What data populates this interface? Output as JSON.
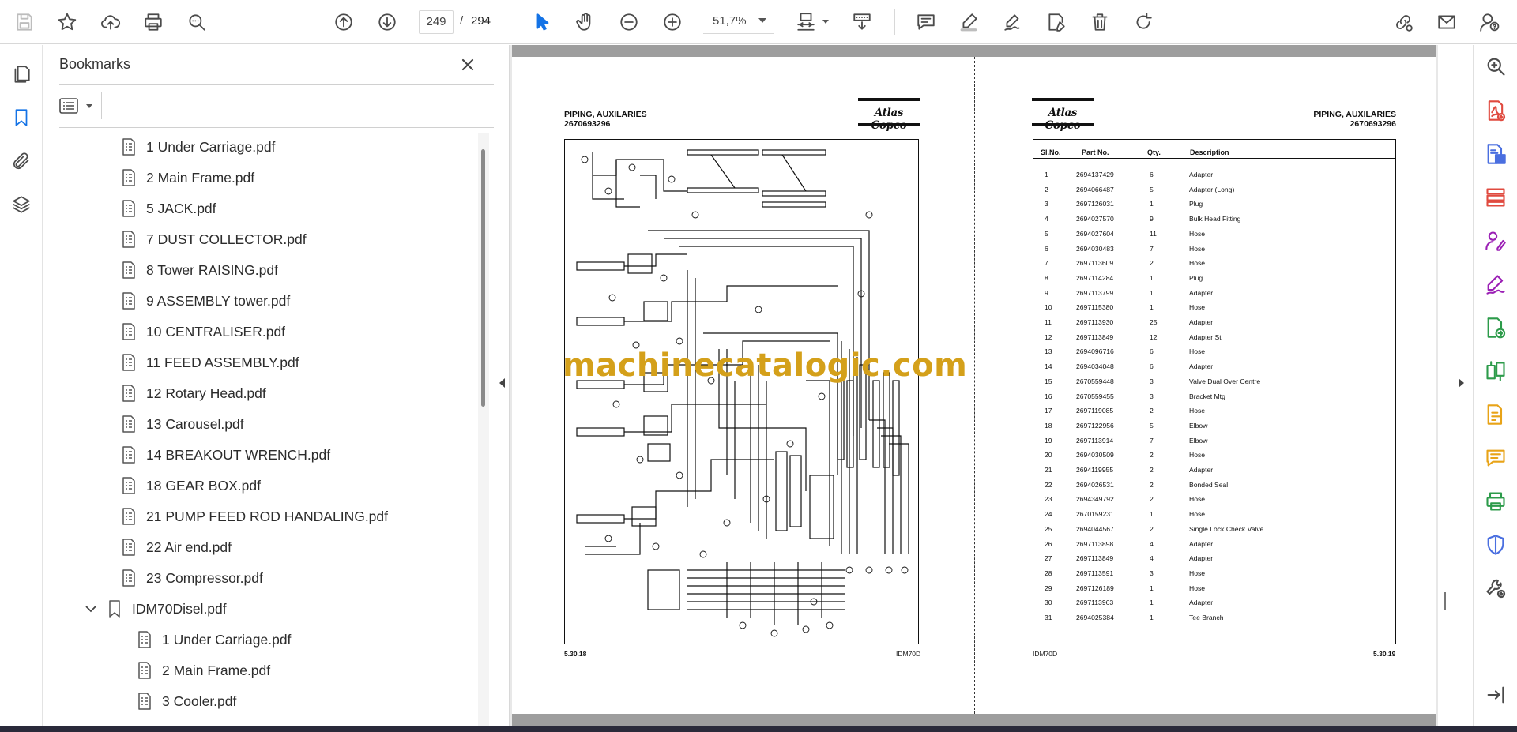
{
  "toolbar": {
    "current_page": "249",
    "page_separator": "/",
    "total_pages": "294",
    "zoom": "51,7%"
  },
  "bookmarks": {
    "title": "Bookmarks",
    "items": [
      {
        "label": "1 Under Carriage.pdf",
        "level": 1
      },
      {
        "label": "2 Main Frame.pdf",
        "level": 1
      },
      {
        "label": "5 JACK.pdf",
        "level": 1
      },
      {
        "label": "7 DUST COLLECTOR.pdf",
        "level": 1
      },
      {
        "label": "8 Tower RAISING.pdf",
        "level": 1
      },
      {
        "label": "9 ASSEMBLY tower.pdf",
        "level": 1
      },
      {
        "label": "10 CENTRALISER.pdf",
        "level": 1
      },
      {
        "label": "11 FEED ASSEMBLY.pdf",
        "level": 1
      },
      {
        "label": "12 Rotary Head.pdf",
        "level": 1
      },
      {
        "label": "13 Carousel.pdf",
        "level": 1
      },
      {
        "label": "14 BREAKOUT WRENCH.pdf",
        "level": 1
      },
      {
        "label": "18 GEAR BOX.pdf",
        "level": 1
      },
      {
        "label": "21 PUMP FEED ROD HANDALING.pdf",
        "level": 1
      },
      {
        "label": "22 Air end.pdf",
        "level": 1
      },
      {
        "label": "23 Compressor.pdf",
        "level": 1
      },
      {
        "label": "IDM70Disel.pdf",
        "level": 0
      },
      {
        "label": "1 Under Carriage.pdf",
        "level": 2
      },
      {
        "label": "2 Main Frame.pdf",
        "level": 2
      },
      {
        "label": "3 Cooler.pdf",
        "level": 2
      }
    ]
  },
  "left_page": {
    "title_line1": "PIPING, AUXILARIES",
    "title_line2": "2670693296",
    "brand": "Atlas Copco",
    "footer_left": "5.30.18",
    "footer_right": "IDM70D"
  },
  "right_page": {
    "title_line1": "PIPING, AUXILARIES",
    "title_line2": "2670693296",
    "brand": "Atlas Copco",
    "footer_left": "IDM70D",
    "footer_right": "5.30.19",
    "headers": {
      "sl": "Sl.No.",
      "part": "Part No.",
      "qty": "Qty.",
      "desc": "Description"
    },
    "rows": [
      [
        "1",
        "2694137429",
        "6",
        "Adapter"
      ],
      [
        "2",
        "2694066487",
        "5",
        "Adapter (Long)"
      ],
      [
        "3",
        "2697126031",
        "1",
        "Plug"
      ],
      [
        "4",
        "2694027570",
        "9",
        "Bulk Head Fitting"
      ],
      [
        "5",
        "2694027604",
        "11",
        "Hose"
      ],
      [
        "6",
        "2694030483",
        "7",
        "Hose"
      ],
      [
        "7",
        "2697113609",
        "2",
        "Hose"
      ],
      [
        "8",
        "2697114284",
        "1",
        "Plug"
      ],
      [
        "9",
        "2697113799",
        "1",
        "Adapter"
      ],
      [
        "10",
        "2697115380",
        "1",
        "Hose"
      ],
      [
        "11",
        "2697113930",
        "25",
        "Adapter"
      ],
      [
        "12",
        "2697113849",
        "12",
        "Adapter St"
      ],
      [
        "13",
        "2694096716",
        "6",
        "Hose"
      ],
      [
        "14",
        "2694034048",
        "6",
        "Adapter"
      ],
      [
        "15",
        "2670559448",
        "3",
        "Valve Dual Over Centre"
      ],
      [
        "16",
        "2670559455",
        "3",
        "Bracket Mtg"
      ],
      [
        "17",
        "2697119085",
        "2",
        "Hose"
      ],
      [
        "18",
        "2697122956",
        "5",
        "Elbow"
      ],
      [
        "19",
        "2697113914",
        "7",
        "Elbow"
      ],
      [
        "20",
        "2694030509",
        "2",
        "Hose"
      ],
      [
        "21",
        "2694119955",
        "2",
        "Adapter"
      ],
      [
        "22",
        "2694026531",
        "2",
        "Bonded Seal"
      ],
      [
        "23",
        "2694349792",
        "2",
        "Hose"
      ],
      [
        "24",
        "2670159231",
        "1",
        "Hose"
      ],
      [
        "25",
        "2694044567",
        "2",
        "Single Lock Check Valve"
      ],
      [
        "26",
        "2697113898",
        "4",
        "Adapter"
      ],
      [
        "27",
        "2697113849",
        "4",
        "Adapter"
      ],
      [
        "28",
        "2697113591",
        "3",
        "Hose"
      ],
      [
        "29",
        "2697126189",
        "1",
        "Hose"
      ],
      [
        "30",
        "2697113963",
        "1",
        "Adapter"
      ],
      [
        "31",
        "2694025384",
        "1",
        "Tee Branch"
      ]
    ]
  },
  "watermark": "machinecatalogic.com",
  "colors": {
    "accent": "#1473e6",
    "tools_purple": "#9b1fb5",
    "tools_red": "#e04a3f",
    "tools_green": "#2c9b4a",
    "tools_yellow": "#e8a317",
    "watermark": "#d4a01a"
  }
}
